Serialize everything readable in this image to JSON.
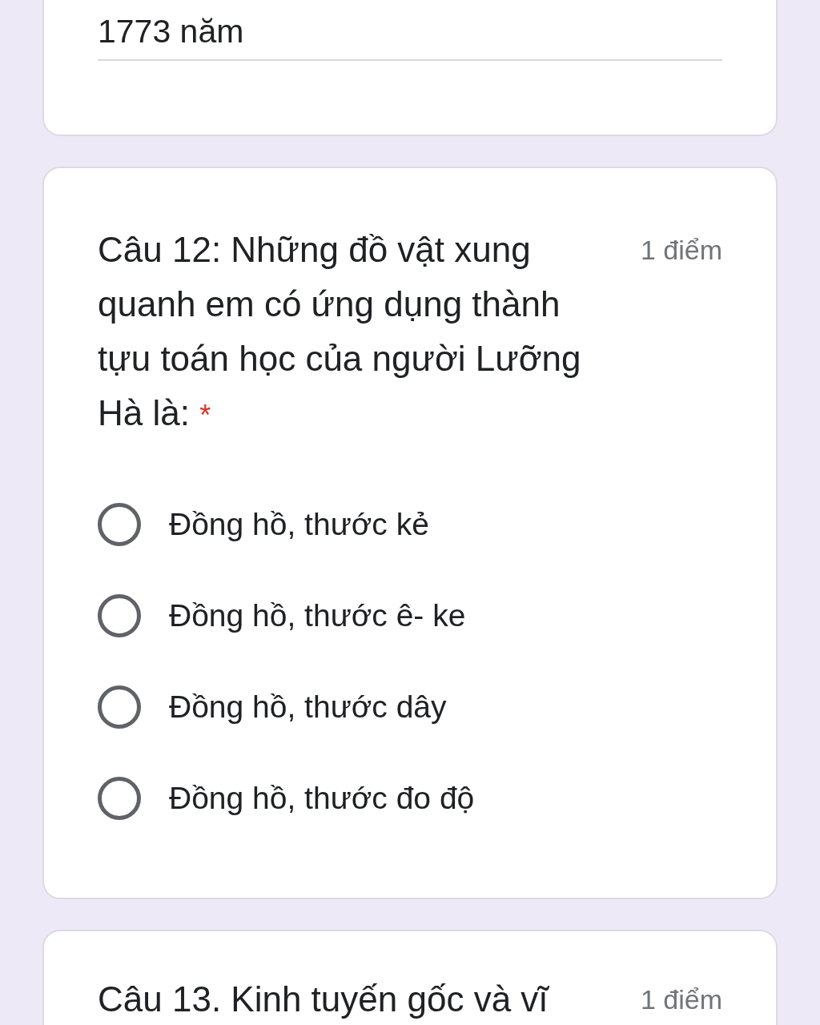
{
  "answer_card": {
    "answer": {
      "value": "1773 năm"
    }
  },
  "questions": [
    {
      "title": "Câu 12: Những đồ vật xung quanh em có ứng dụng thành tựu toán học của người Lưỡng Hà là:",
      "required_mark": "*",
      "points": "1 điểm",
      "options": [
        {
          "label": "Đồng hồ, thước kẻ",
          "selected": false
        },
        {
          "label": "Đồng hồ, thước ê- ke",
          "selected": false
        },
        {
          "label": "Đồng hồ, thước dây",
          "selected": false
        },
        {
          "label": "Đồng hồ, thước đo độ",
          "selected": false
        }
      ]
    },
    {
      "title": "Câu 13. Kinh tuyến gốc và vĩ",
      "points": "1 điểm"
    }
  ]
}
